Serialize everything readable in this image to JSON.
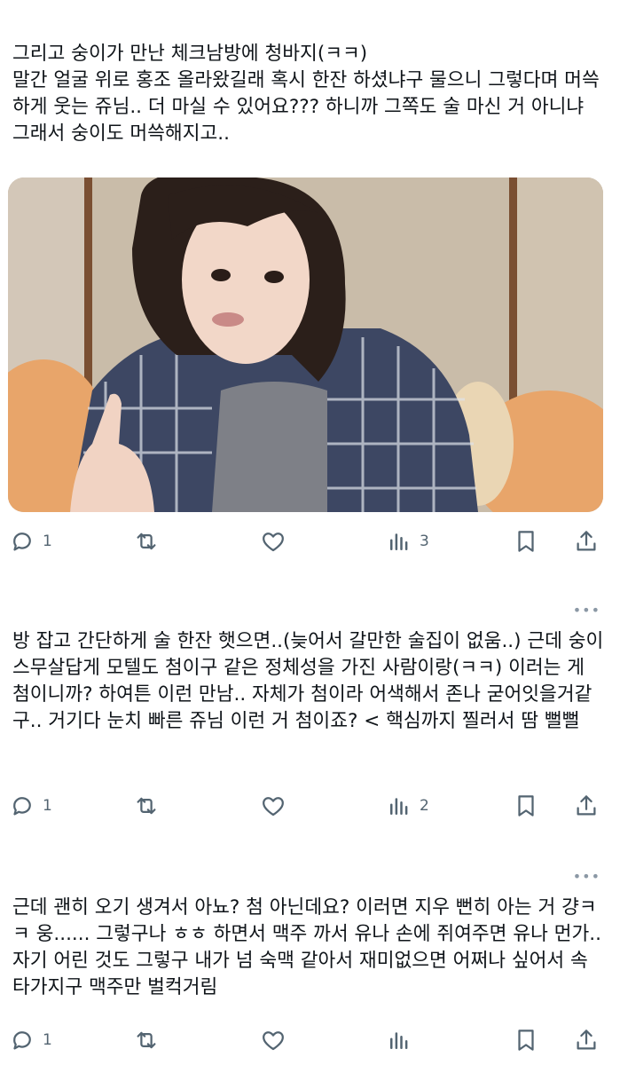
{
  "tweets": [
    {
      "text": "그리고 숭이가 만난 체크남방에 청바지(ㅋㅋ)\n말간 얼굴 위로 홍조 올라왔길래 혹시 한잔 하셨냐구 물으니 그렇다며 머쓱하게 웃는 쥬님.. 더 마실 수 있어요??? 하니까 그쪽도 술 마신 거 아니냐 그래서 숭이도 머쓱해지고..",
      "has_media": true,
      "media_alt": "photo of a person in a plaid shirt",
      "reply_count": "1",
      "retweet_count": "",
      "like_count": "",
      "view_count": "3"
    },
    {
      "text": "방 잡고 간단하게 술 한잔 햇으면..(늦어서 갈만한 술집이 없움..) 근데 숭이 스무살답게 모텔도 첨이구 같은 정체성을 가진 사람이랑(ㅋㅋ) 이러는 게 첨이니까? 하여튼 이런 만남.. 자체가 첨이라 어색해서 존나 굳어잇을거같구.. 거기다 눈치 빠른 쥬님 이런 거 첨이죠? < 핵심까지 찔러서 땀 뻘뻘",
      "has_media": false,
      "reply_count": "1",
      "retweet_count": "",
      "like_count": "",
      "view_count": "2"
    },
    {
      "text": "근데 괜히 오기 생겨서 아뇨? 첨 아닌데요? 이러면 지우 뻔히 아는 거 걍ㅋㅋ 웅...... 그렇구나 ㅎㅎ 하면서 맥주 까서 유나 손에 쥐여주면 유나 먼가.. 자기 어린 것도 그렇구 내가 넘 숙맥 같아서 재미없으면 어쩌나 싶어서 속 타가지구 맥주만 벌컥거림",
      "has_media": false,
      "reply_count": "1",
      "retweet_count": "",
      "like_count": "",
      "view_count": ""
    }
  ],
  "icons": [
    "reply-icon",
    "retweet-icon",
    "like-icon",
    "views-icon",
    "bookmark-icon",
    "share-icon",
    "more-icon"
  ],
  "colors": {
    "icon": "#536471",
    "text": "#0f1419",
    "muted": "#8b98a5",
    "background": "#ffffff"
  }
}
